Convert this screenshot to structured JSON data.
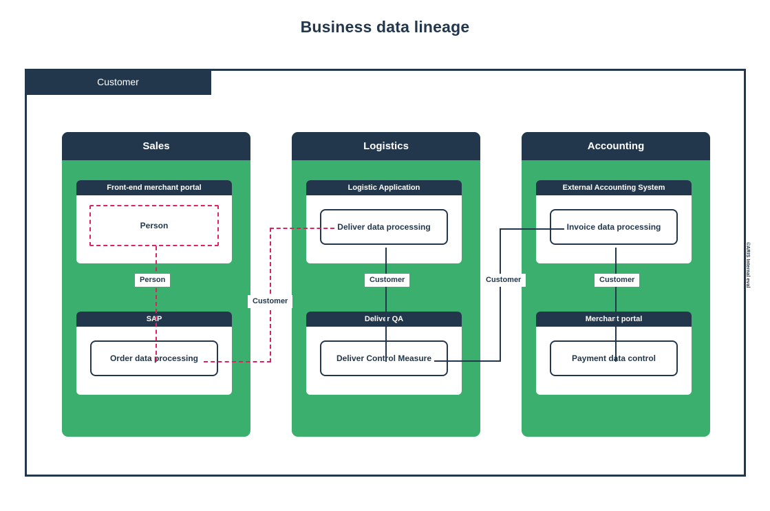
{
  "title": "Business data lineage",
  "pool": {
    "label": "Customer"
  },
  "watermark": "©ARIS Internal eval",
  "colors": {
    "navy": "#22374c",
    "green": "#3bb06e",
    "pink": "#dd2060",
    "white": "#ffffff"
  },
  "departments": [
    {
      "name": "Sales",
      "systems": [
        {
          "name": "Front-end merchant portal",
          "node": "Person",
          "node_style": "data-object"
        },
        {
          "name": "SAP",
          "node": "Order data processing",
          "node_style": "function"
        }
      ]
    },
    {
      "name": "Logistics",
      "systems": [
        {
          "name": "Logistic Application",
          "node": "Deliver data processing",
          "node_style": "function"
        },
        {
          "name": "Deliver QA",
          "node": "Deliver Control Measure",
          "node_style": "function"
        }
      ]
    },
    {
      "name": "Accounting",
      "systems": [
        {
          "name": "External Accounting System",
          "node": "Invoice data processing",
          "node_style": "function"
        },
        {
          "name": "Merchant portal",
          "node": "Payment data control",
          "node_style": "function"
        }
      ]
    }
  ],
  "edge_labels": [
    {
      "id": "sales_person",
      "text": "Person"
    },
    {
      "id": "sales_to_logistics",
      "text": "Customer"
    },
    {
      "id": "logistics_customer",
      "text": "Customer"
    },
    {
      "id": "logistics_to_acct",
      "text": "Customer"
    },
    {
      "id": "accounting_customer",
      "text": "Customer"
    }
  ]
}
